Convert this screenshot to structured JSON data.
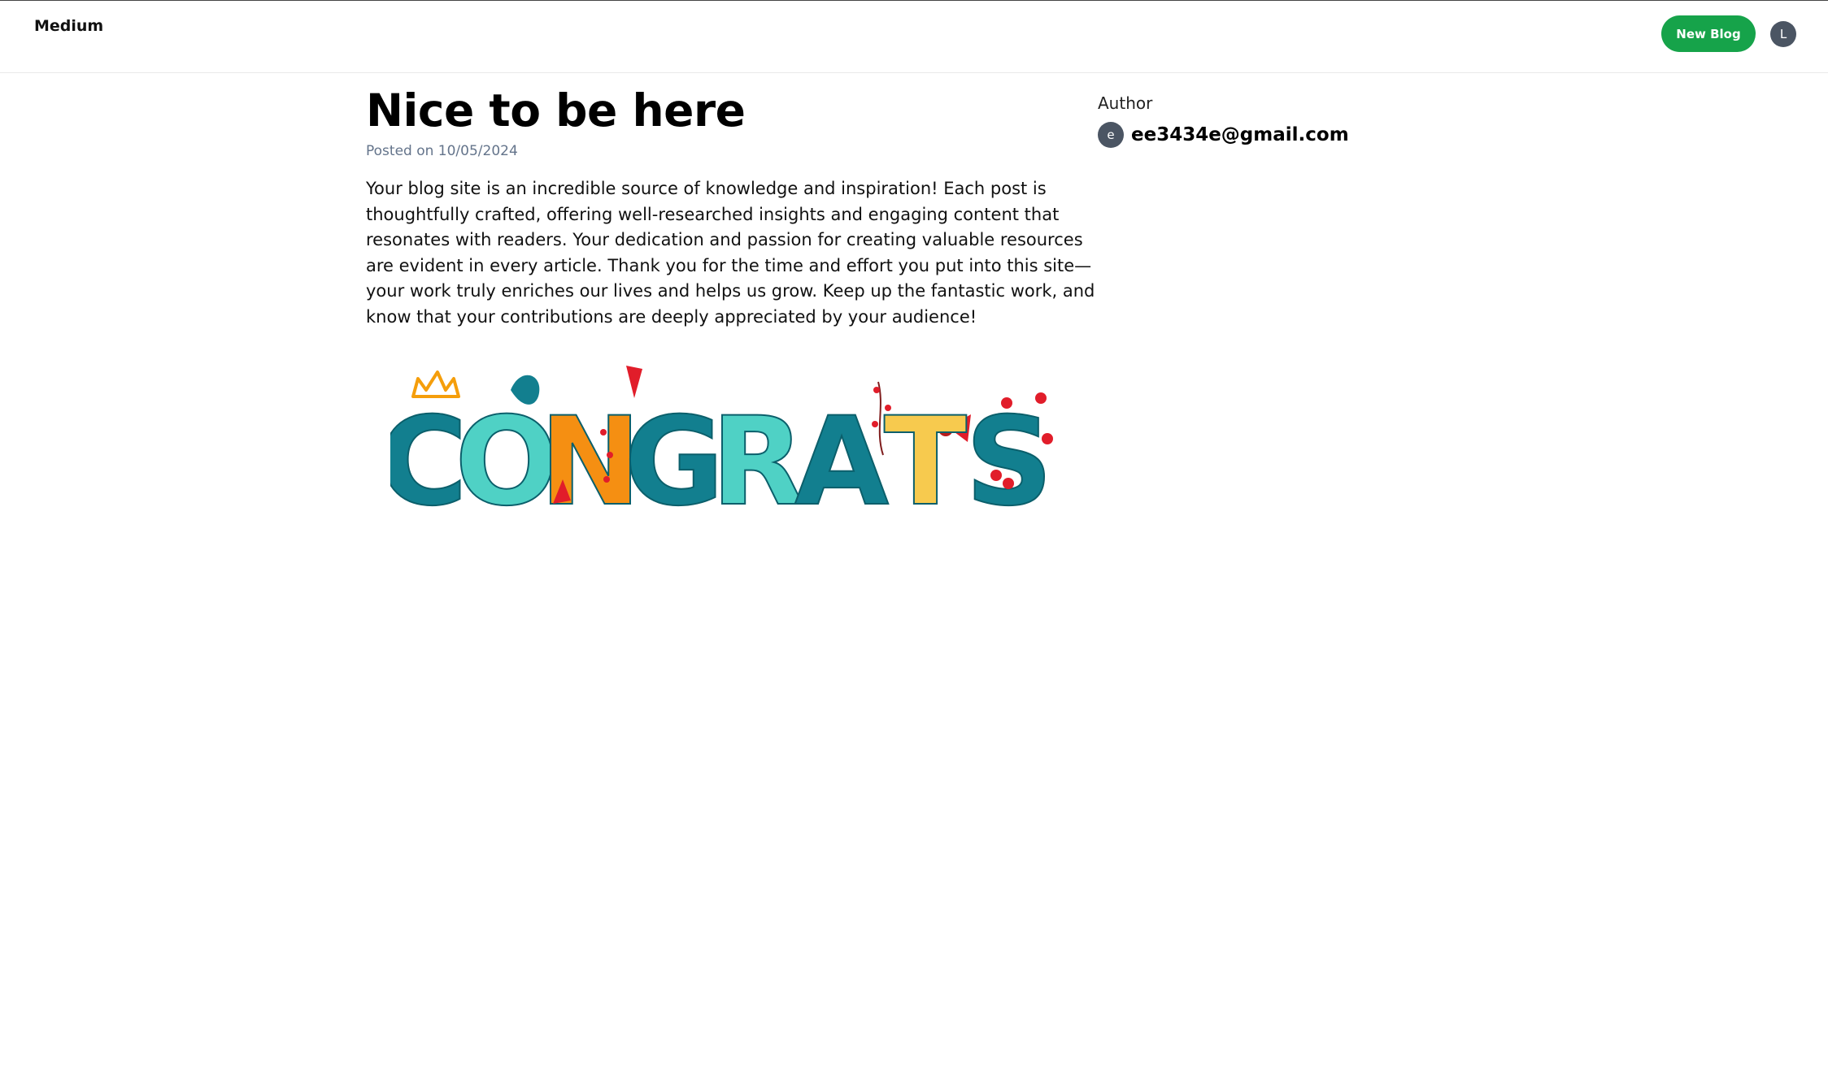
{
  "header": {
    "brand": "Medium",
    "new_blog_label": "New Blog",
    "user_initial": "L",
    "accent_color": "#16a34a"
  },
  "post": {
    "title": "Nice to be here",
    "posted_on": "Posted on 10/05/2024",
    "content": "Your blog site is an incredible source of knowledge and inspiration! Each post is thoughtfully crafted, offering well-researched insights and engaging content that resonates with readers. Your dedication and passion for creating valuable resources are evident in every article. Thank you for the time and effort you put into this site—your work truly enriches our lives and helps us grow. Keep up the fantastic work, and know that your contributions are deeply appreciated by your audience!",
    "image": {
      "letters": [
        "C",
        "O",
        "N",
        "G",
        "R",
        "A",
        "T",
        "S"
      ],
      "colors": [
        "#127f8f",
        "#4fd1c5",
        "#f58f12",
        "#127f8f",
        "#4fd1c5",
        "#127f8f",
        "#f7ca4e",
        "#127f8f"
      ],
      "accent_colors": [
        "#e11d2a",
        "#f59e0b"
      ]
    }
  },
  "author": {
    "heading": "Author",
    "initial": "e",
    "email": "ee3434e@gmail.com"
  }
}
